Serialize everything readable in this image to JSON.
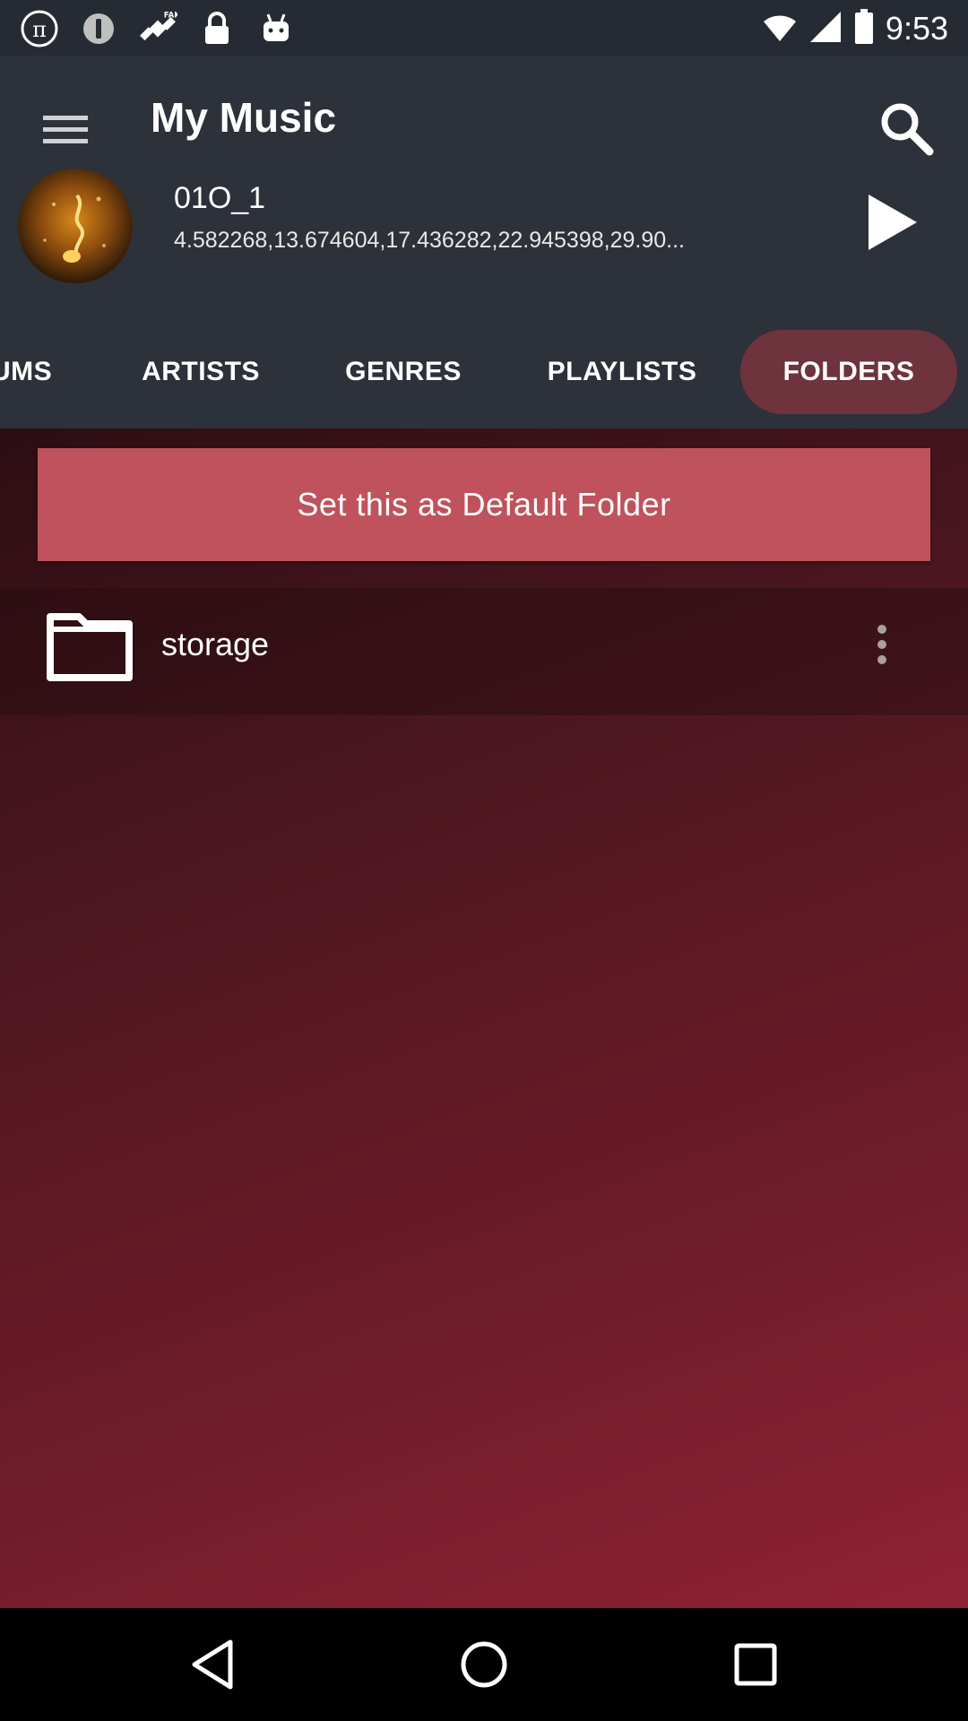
{
  "status_bar": {
    "time": "9:53",
    "icons": [
      "pi-icon",
      "info-icon",
      "satellite-fake-gps-icon",
      "lock-icon",
      "android-icon"
    ]
  },
  "header": {
    "title": "My Music",
    "now_playing": {
      "title": "01O_1",
      "subtitle": "4.582268,13.674604,17.436282,22.945398,29.90..."
    }
  },
  "tabs": [
    {
      "label": "UMS",
      "active": false
    },
    {
      "label": "ARTISTS",
      "active": false
    },
    {
      "label": "GENRES",
      "active": false
    },
    {
      "label": "PLAYLISTS",
      "active": false
    },
    {
      "label": "FOLDERS",
      "active": true
    }
  ],
  "main": {
    "default_folder_label": "Set this as Default Folder",
    "folders": [
      {
        "name": "storage"
      }
    ]
  },
  "nav": {
    "icons": [
      "back-icon",
      "home-icon",
      "recents-icon"
    ]
  },
  "colors": {
    "status_bar": "#262b33",
    "header": "#2d3139",
    "active_tab": "#6e333c",
    "button": "#bf525c",
    "background_top": "#2c0e13",
    "background_bottom": "#8f2234"
  }
}
